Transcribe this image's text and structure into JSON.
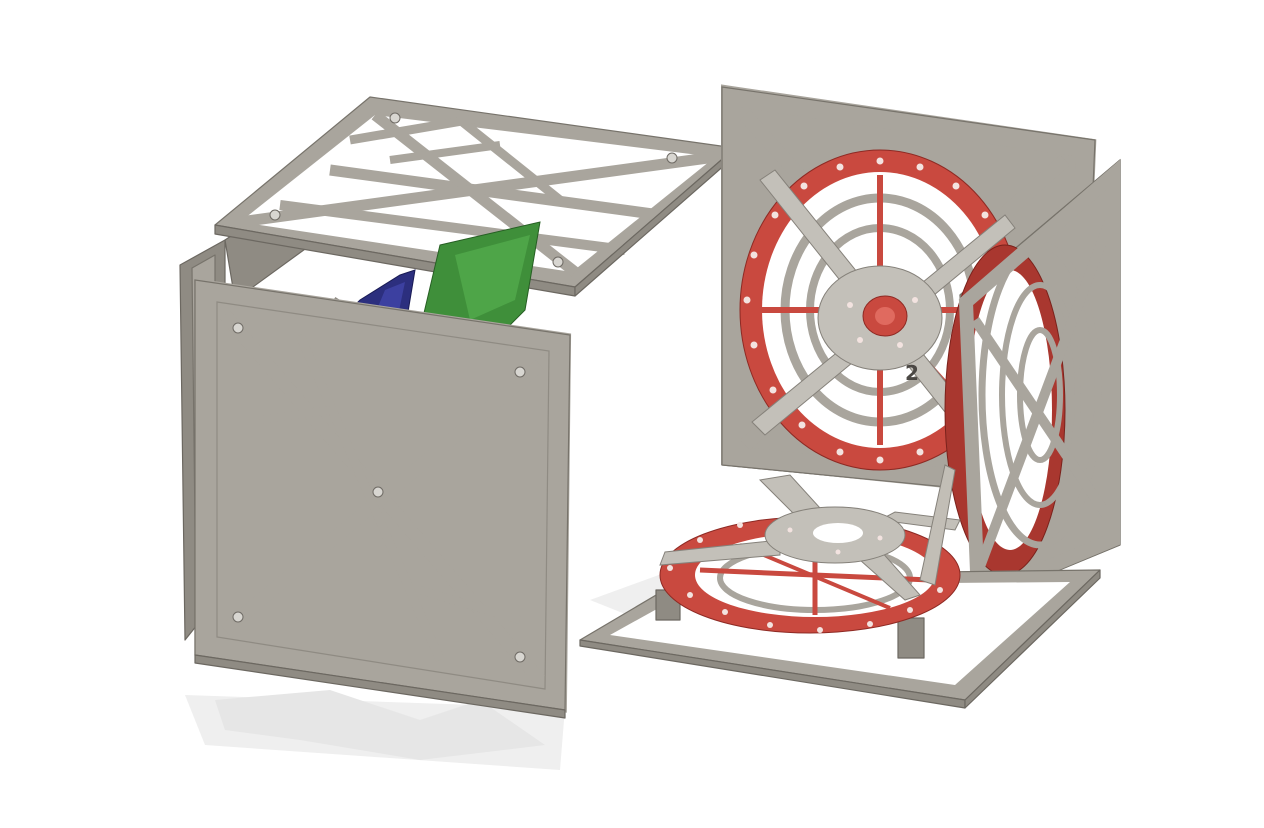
{
  "scene": {
    "engraved_digit": "2"
  },
  "colors": {
    "background": "#ffffff",
    "frame": "#a9a59d",
    "wheel": "#c9493f",
    "bracket_green": "#3f8f3a",
    "bracket_blue": "#2c2f7e",
    "bracket_yellow": "#e6a92a",
    "shadow": "#e6e6e6"
  }
}
